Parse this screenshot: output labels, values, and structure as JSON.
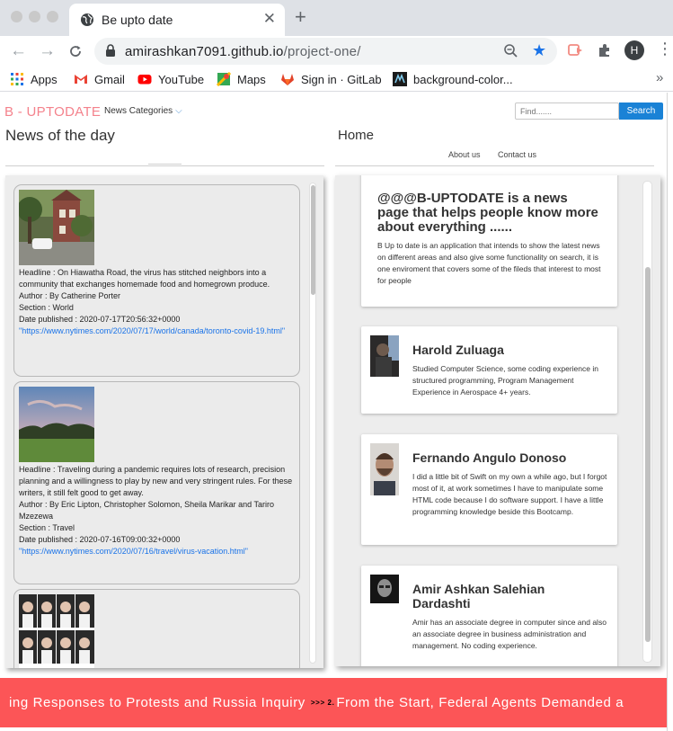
{
  "browser": {
    "tab_title": "Be upto date",
    "url_host": "amirashkan7091.github.io",
    "url_path": "/project-one/",
    "avatar_letter": "H",
    "bookmarks": [
      "Apps",
      "Gmail",
      "YouTube",
      "Maps",
      "Sign in · GitLab",
      "background-color..."
    ]
  },
  "header": {
    "brand": "B - UPTODATE",
    "categories": "News Categories",
    "search_placeholder": "Find.......",
    "search_button": "Search"
  },
  "news": {
    "title": "News of the day",
    "items": [
      {
        "headline": "Headline : On Hiawatha Road, the virus has stitched neighbors into a community that exchanges homemade food and homegrown produce.",
        "author": "Author : By Catherine Porter",
        "section": "Section : World",
        "date": "Date published : 2020-07-17T20:56:32+0000",
        "link": "\"https://www.nytimes.com/2020/07/17/world/canada/toronto-covid-19.html\""
      },
      {
        "headline": "Headline : Traveling during a pandemic requires lots of research, precision planning and a willingness to play by new and very stringent rules. For these writers, it still felt good to get away.",
        "author": "Author : By Eric Lipton, Christopher Solomon, Sheila Marikar and Tariro Mzezewa",
        "section": "Section : Travel",
        "date": "Date published : 2020-07-16T09:00:32+0000",
        "link": "\"https://www.nytimes.com/2020/07/16/travel/virus-vacation.html\""
      }
    ]
  },
  "home": {
    "title": "Home",
    "links": [
      "About us",
      "Contact us"
    ],
    "intro_heading": "@@@B-UPTODATE is a news page that helps people know more about everything ......",
    "intro_body": "B Up to date is an application that intends to show the latest news on different areas and also give some functionality on search, it is one enviroment that covers some of the fileds that interest to most for people",
    "team": [
      {
        "name": "Harold Zuluaga",
        "bio": "Studied Computer Science, some coding experience in structured programming, Program Management Experience in Aerospace 4+ years."
      },
      {
        "name": "Fernando Angulo Donoso",
        "bio": "I did a little bit of Swift on my own a while ago, but I forgot most of it, at work sometimes I have to manipulate some HTML code because I do software support. I have a little programming knowledge beside this Bootcamp."
      },
      {
        "name": "Amir Ashkan Salehian Dardashti",
        "bio": "Amir has an associate degree in computer since and also an associate degree in business administration and management. No coding experience."
      }
    ]
  },
  "ticker": {
    "text_before": "ing Responses to Protests and Russia Inquiry",
    "separator": ">>> 2.",
    "text_after": "From the Start, Federal Agents Demanded a"
  }
}
